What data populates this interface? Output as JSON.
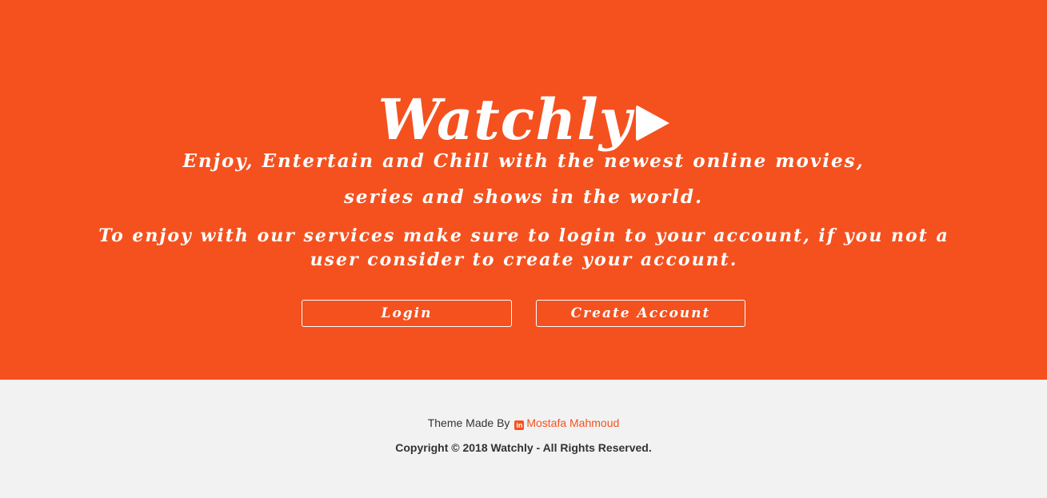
{
  "hero": {
    "logo_text": "Watchly",
    "logo_icon": "play-icon",
    "tagline_line1": "Enjoy, Entertain and Chill with the newest online movies,",
    "tagline_line2": "series and shows in the world.",
    "notice": "To enjoy with our services make sure to login to your account, if you not a user consider to create your account.",
    "login_label": "Login",
    "create_account_label": "Create Account"
  },
  "footer": {
    "credit_prefix": "Theme Made By",
    "author_icon": "linkedin-icon",
    "author_name": "Mostafa Mahmoud",
    "copyright": "Copyright © 2018 Watchly - All Rights Reserved."
  },
  "colors": {
    "brand": "#f5511f",
    "footer_bg": "#f2f2f2",
    "text_dark": "#333333"
  }
}
